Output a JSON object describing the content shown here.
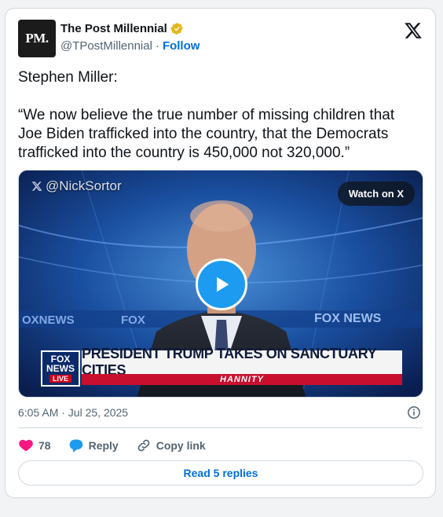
{
  "author": {
    "avatar_text": "PM.",
    "display_name": "The Post Millennial",
    "handle": "@TPostMillennial",
    "separator": "·",
    "follow_label": "Follow"
  },
  "tweet": {
    "text": "Stephen Miller:\n\n“We now believe the true number of missing children that Joe Biden trafficked into the country, that the Democrats trafficked into the country is 450,000 not 320,000.”"
  },
  "media": {
    "watermark": "@NickSortor",
    "watch_label": "Watch on X",
    "chyron_logo_top": "FOX",
    "chyron_logo_bottom": "NEWS",
    "chyron_live": "LIVE",
    "chyron_headline": "PRESIDENT TRUMP TAKES ON SANCTUARY CITIES",
    "chyron_show": "HANNITY"
  },
  "meta": {
    "timestamp": "6:05 AM · Jul 25, 2025"
  },
  "actions": {
    "like_count": "78",
    "reply_label": "Reply",
    "copy_label": "Copy link",
    "read_replies_label": "Read 5 replies"
  },
  "colors": {
    "accent": "#1d9bf0",
    "link": "#006fd6",
    "like": "#f91880",
    "verified_gold": "#e2b719"
  }
}
